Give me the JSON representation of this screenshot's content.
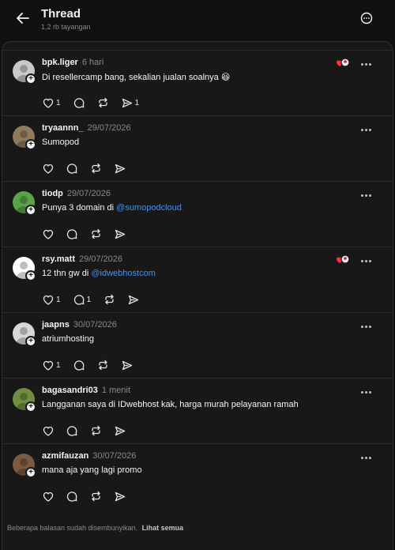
{
  "header": {
    "title": "Thread",
    "subtitle": "1,2 rb tayangan"
  },
  "posts": [
    {
      "username": "bpk.liger",
      "time": "6 hari",
      "text": "Di resellercamp bang, sekalian jualan soalnya 😆",
      "text_before": "",
      "mention": "",
      "likes": "1",
      "replies": "",
      "shares": "1",
      "liked_badge": true,
      "avatar_color": "#c9c9c9"
    },
    {
      "username": "tryaannn_",
      "time": "29/07/2026",
      "text_before": "",
      "text": "Sumopod",
      "mention": "",
      "likes": "",
      "replies": "",
      "shares": "",
      "liked_badge": false,
      "avatar_color": "#8f7b5c"
    },
    {
      "username": "tiodp",
      "time": "29/07/2026",
      "text_before": "Punya 3 domain di ",
      "text": "",
      "mention": "@sumopodcloud",
      "likes": "",
      "replies": "",
      "shares": "",
      "liked_badge": false,
      "avatar_color": "#5aa34a"
    },
    {
      "username": "rsy.matt",
      "time": "29/07/2026",
      "text_before": "12 thn gw di ",
      "text": "",
      "mention": "@idwebhostcom",
      "likes": "1",
      "replies": "1",
      "shares": "",
      "liked_badge": true,
      "avatar_color": "#ffffff"
    },
    {
      "username": "jaapns",
      "time": "30/07/2026",
      "text_before": "",
      "text": "atriumhosting",
      "mention": "",
      "likes": "1",
      "replies": "",
      "shares": "",
      "liked_badge": false,
      "avatar_color": "#d8d8d8"
    },
    {
      "username": "bagasandri03",
      "time": "1 menit",
      "text_before": "",
      "text": "Langganan saya di IDwebhost kak, harga murah pelayanan ramah",
      "mention": "",
      "likes": "",
      "replies": "",
      "shares": "",
      "liked_badge": false,
      "avatar_color": "#6f8f3f"
    },
    {
      "username": "azmifauzan",
      "time": "30/07/2026",
      "text_before": "",
      "text": "mana aja yang lagi promo",
      "mention": "",
      "likes": "",
      "replies": "",
      "shares": "",
      "liked_badge": false,
      "avatar_color": "#7a5a40"
    }
  ],
  "footer": {
    "text": "Beberapa balasan sudah disembunyikan.",
    "link": "Lihat semua"
  },
  "colors": {
    "background": "#101010",
    "card": "#181818",
    "border": "#2c2c2c",
    "mention": "#4a90e2",
    "like_red": "#ff3040"
  }
}
